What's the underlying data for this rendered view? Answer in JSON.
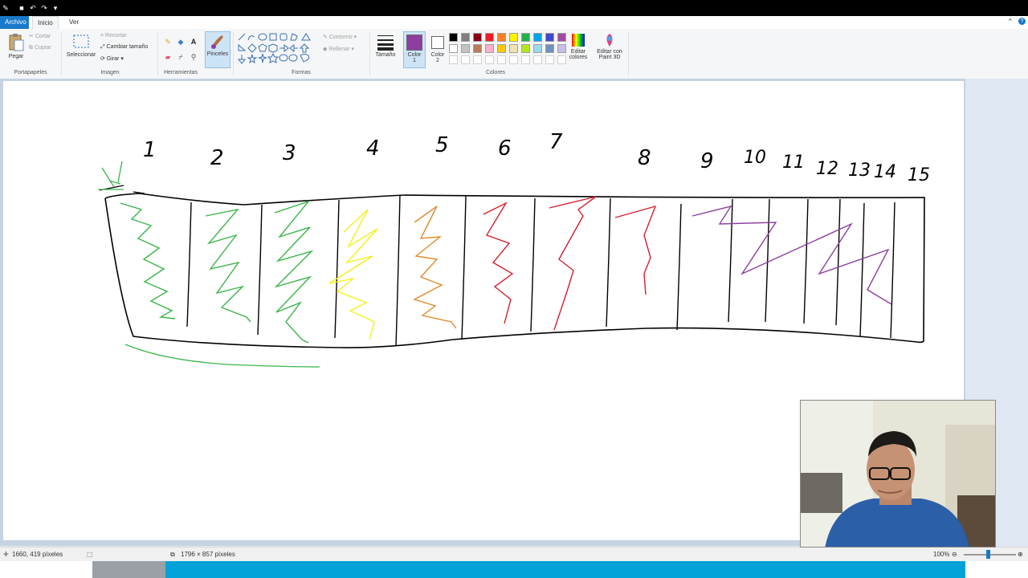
{
  "tabs": {
    "file": "Archivo",
    "home": "Inicio",
    "view": "Ver"
  },
  "clipboard": {
    "paste": "Pegar",
    "cut": "Cortar",
    "copy": "Copiar",
    "label": "Portapapeles"
  },
  "image": {
    "select": "Seleccionar",
    "crop": "Recortar",
    "resize": "Cambiar tamaño",
    "rotate": "Girar",
    "label": "Imagen"
  },
  "tools": {
    "label": "Herramientas"
  },
  "brushes": {
    "label": "Pinceles"
  },
  "shapes": {
    "outline": "Contorno",
    "fill": "Rellenar",
    "label": "Formas"
  },
  "size": {
    "label": "Tamaño"
  },
  "colors": {
    "color1_label": "Color",
    "color1_num": "1",
    "color2_label": "Color",
    "color2_num": "2",
    "edit_colors_1": "Editar",
    "edit_colors_2": "colores",
    "paint3d_1": "Editar con",
    "paint3d_2": "Paint 3D",
    "label": "Colores",
    "color1": "#8e3ea0",
    "color2": "#ffffff",
    "palette_row1": [
      "#000000",
      "#7f7f7f",
      "#880015",
      "#ed1c24",
      "#ff7f27",
      "#fff200",
      "#22b14c",
      "#00a2e8",
      "#3f48cc",
      "#a349a4"
    ],
    "palette_row2": [
      "#ffffff",
      "#c3c3c3",
      "#b97a57",
      "#ffaec9",
      "#ffc90e",
      "#efe4b0",
      "#b5e61d",
      "#99d9ea",
      "#7092be",
      "#c8bfe7"
    ]
  },
  "drawing": {
    "numbers": [
      "1",
      "2",
      "3",
      "4",
      "5",
      "6",
      "7",
      "8",
      "9",
      "10",
      "11",
      "12",
      "13",
      "14",
      "15"
    ],
    "stroke_colors": {
      "black": "#000000",
      "green": "#3ab54a",
      "yellow": "#f4f01a",
      "orange": "#e08a2c",
      "red": "#d3202e",
      "purple": "#8e3ea0"
    }
  },
  "status": {
    "cursor": "1660, 419 píxeles",
    "dimensions": "1796 × 857 píxeles",
    "zoom": "100%"
  }
}
